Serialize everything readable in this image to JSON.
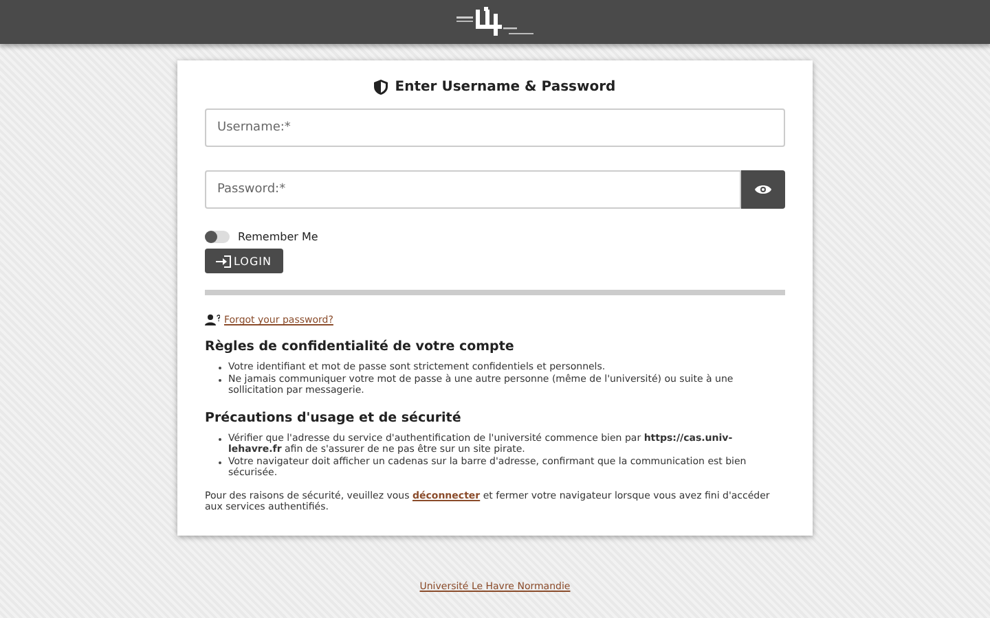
{
  "form": {
    "title": "Enter Username & Password",
    "username": {
      "placeholder": "Username:*"
    },
    "password": {
      "placeholder": "Password:*"
    },
    "remember_me": {
      "label": "Remember Me",
      "on": false
    },
    "login_button": "LOGIN",
    "forgot_link": "Forgot your password?"
  },
  "sections": [
    {
      "heading": "Règles de confidentialité de votre compte",
      "items": [
        "Votre identifiant et mot de passe sont strictement confidentiels et personnels.",
        "Ne jamais communiquer votre mot de passe à une autre personne (même de l'université) ou suite à une sollicitation par messagerie."
      ]
    },
    {
      "heading": "Précautions d'usage et de sécurité",
      "items": [
        "Vérifier que l'adresse du service d'authentification de l'université commence bien par **https://cas.univ-lehavre.fr** afin de s'assurer de ne pas être sur un site pirate.",
        "Votre navigateur doit afficher un cadenas sur la barre d'adresse, confirmant que la communication est bien sécurisée."
      ]
    }
  ],
  "notice": {
    "before": "Pour des raisons de sécurité, veuillez vous",
    "link": "déconnecter",
    "after": "et fermer votre navigateur lorsque vous avez fini d'accéder aux services authentifiés."
  },
  "footer_link": "Université Le Havre Normandie"
}
